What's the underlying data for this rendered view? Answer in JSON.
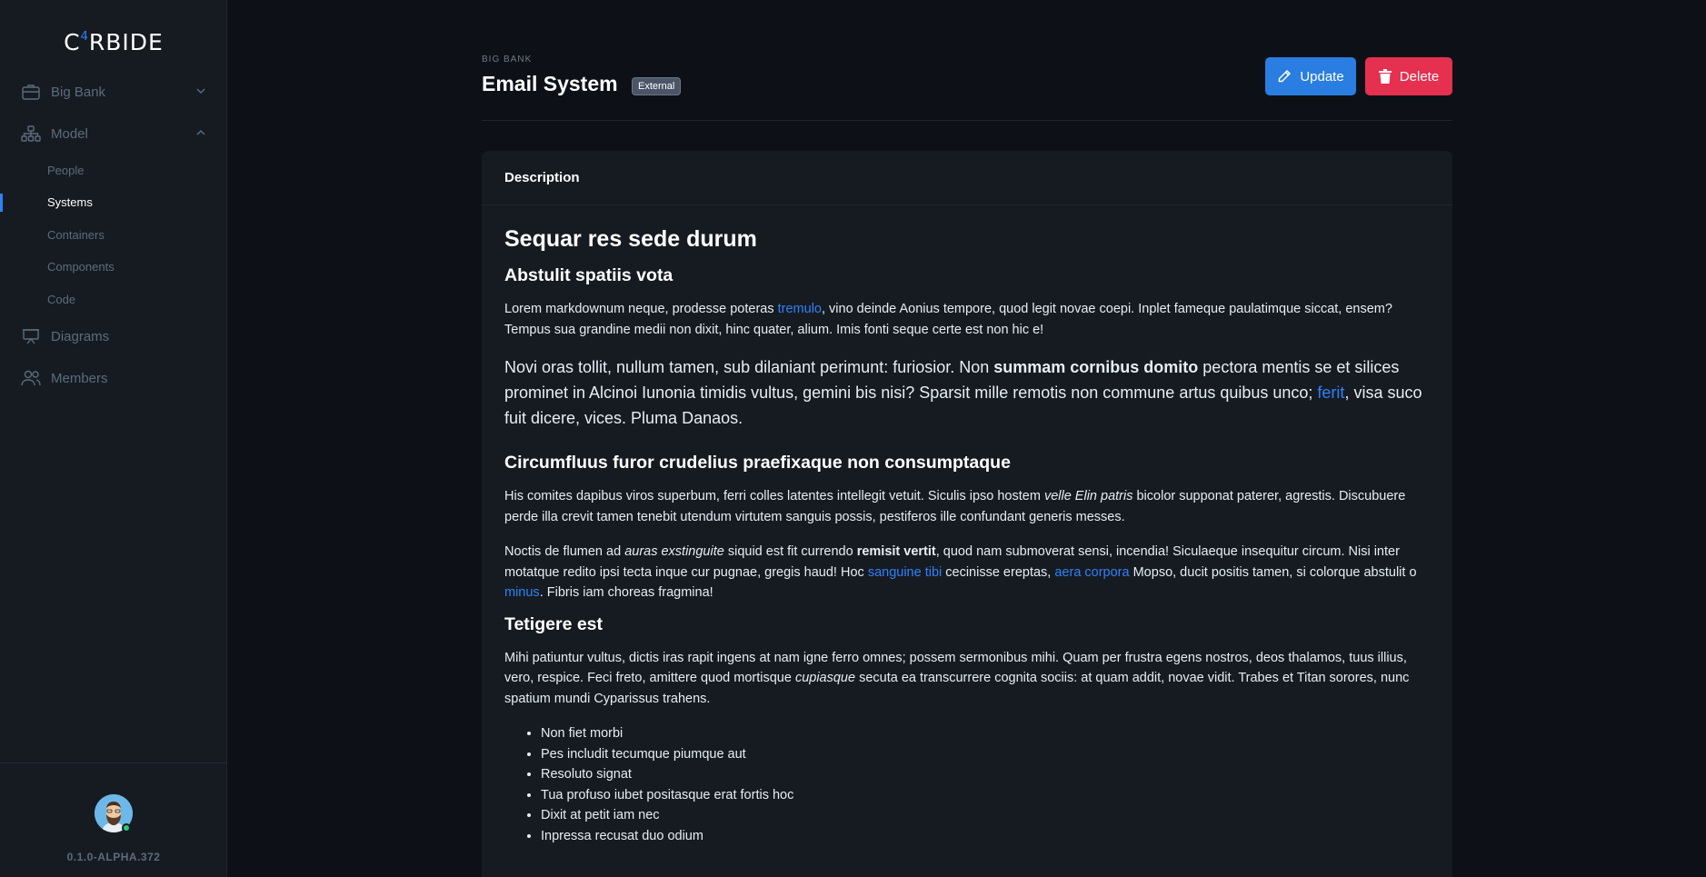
{
  "sidebar": {
    "logo": {
      "pre": "C",
      "sup": "4",
      "post": "RBIDE"
    },
    "workspace": "Big Bank",
    "model": "Model",
    "model_items": [
      "People",
      "Systems",
      "Containers",
      "Components",
      "Code"
    ],
    "diagrams": "Diagrams",
    "members": "Members",
    "version": "0.1.0-ALPHA.372"
  },
  "header": {
    "breadcrumb": "BIG BANK",
    "title": "Email System",
    "badge": "External",
    "update_label": "Update",
    "delete_label": "Delete"
  },
  "card": {
    "header": "Description",
    "h1": "Sequar res sede durum",
    "h2_1": "Abstulit spatiis vota",
    "p1": {
      "a": "Lorem markdownum neque, prodesse poteras ",
      "link": "tremulo",
      "b": ", vino deinde Aonius tempore, quod legit novae coepi. Inplet fameque paulatimque siccat, ensem? Tempus sua grandine medii non dixit, hinc quater, alium. Imis fonti seque certe est non hic e!"
    },
    "p2": {
      "a": "Novi oras tollit, nullum tamen, sub dilaniant perimunt: furiosior. Non ",
      "strong": "summam cornibus domito",
      "b": " pectora mentis se et silices prominet in Alcinoi Iunonia timidis vultus, gemini bis nisi? Sparsit mille remotis non commune artus quibus unco; ",
      "link": "ferit",
      "c": ", visa suco fuit dicere, vices. Pluma Danaos."
    },
    "h2_2": "Circumfluus furor crudelius praefixaque non consumptaque",
    "p3": {
      "a": "His comites dapibus viros superbum, ferri colles latentes intellegit vetuit. Siculis ipso hostem ",
      "em": "velle Elin patris",
      "b": " bicolor supponat paterer, agrestis. Discubuere perde illa crevit tamen tenebit utendum virtutem sanguis possis, pestiferos ille confundant generis messes."
    },
    "p4": {
      "a": "Noctis de flumen ad ",
      "em": "auras exstinguite",
      "b": " siquid est fit currendo ",
      "strong": "remisit vertit",
      "c": ", quod nam submoverat sensi, incendia! Siculaeque insequitur circum. Nisi inter motatque redito ipsi tecta inque cur pugnae, gregis haud! Hoc ",
      "link1": "sanguine tibi",
      "d": " cecinisse ereptas, ",
      "link2": "aera corpora",
      "e": " Mopso, ducit positis tamen, si colorque abstulit o ",
      "link3": "minus",
      "f": ". Fibris iam choreas fragmina!"
    },
    "h2_3": "Tetigere est",
    "p5": {
      "a": "Mihi patiuntur vultus, dictis iras rapit ingens at nam igne ferro omnes; possem sermonibus mihi. Quam per frustra egens nostros, deos thalamos, tuus illius, vero, respice. Feci freto, amittere quod mortisque ",
      "em": "cupiasque",
      "b": " secuta ea transcurrere cognita sociis: at quam addit, novae vidit. Trabes et Titan sorores, nunc spatium mundi Cyparissus trahens."
    },
    "list": [
      "Non fiet morbi",
      "Pes includit tecumque piumque aut",
      "Resoluto signat",
      "Tua profuso iubet positasque erat fortis hoc",
      "Dixit at petit iam nec",
      "Inpressa recusat duo odium"
    ]
  },
  "colors": {
    "accent": "#2f81f7",
    "update": "#2a7de1",
    "delete": "#e5304f",
    "online": "#2ecc71"
  }
}
